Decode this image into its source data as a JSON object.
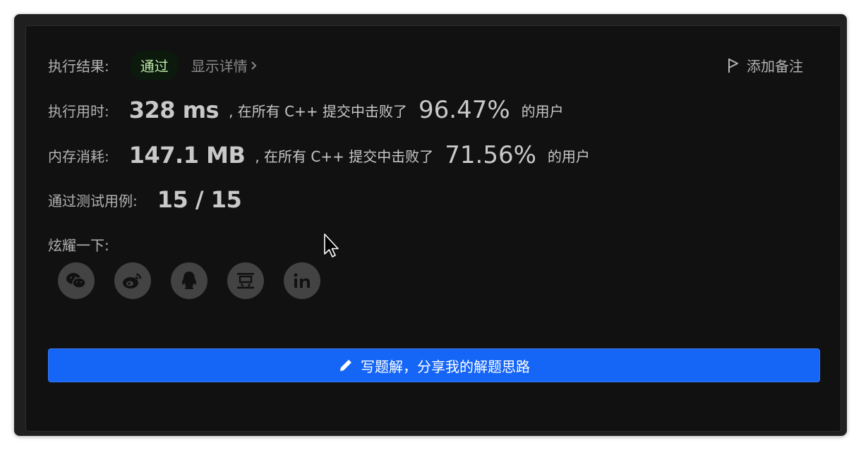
{
  "result": {
    "label": "执行结果:",
    "status": "通过",
    "details_link": "显示详情"
  },
  "add_note": "添加备注",
  "runtime": {
    "label": "执行用时:",
    "value": "328 ms",
    "prefix": ", 在所有 C++ 提交中击败了",
    "percent": "96.47%",
    "suffix": "的用户"
  },
  "memory": {
    "label": "内存消耗:",
    "value": "147.1 MB",
    "prefix": ", 在所有 C++ 提交中击败了",
    "percent": "71.56%",
    "suffix": "的用户"
  },
  "testcases": {
    "label": "通过测试用例:",
    "value": "15 / 15"
  },
  "share": {
    "label": "炫耀一下:",
    "items": [
      {
        "icon": "wechat-icon"
      },
      {
        "icon": "weibo-icon"
      },
      {
        "icon": "qq-icon"
      },
      {
        "icon": "douban-icon",
        "glyph": "豆"
      },
      {
        "icon": "linkedin-icon",
        "glyph": "in"
      }
    ]
  },
  "write_solution": "写题解，分享我的解题思路"
}
